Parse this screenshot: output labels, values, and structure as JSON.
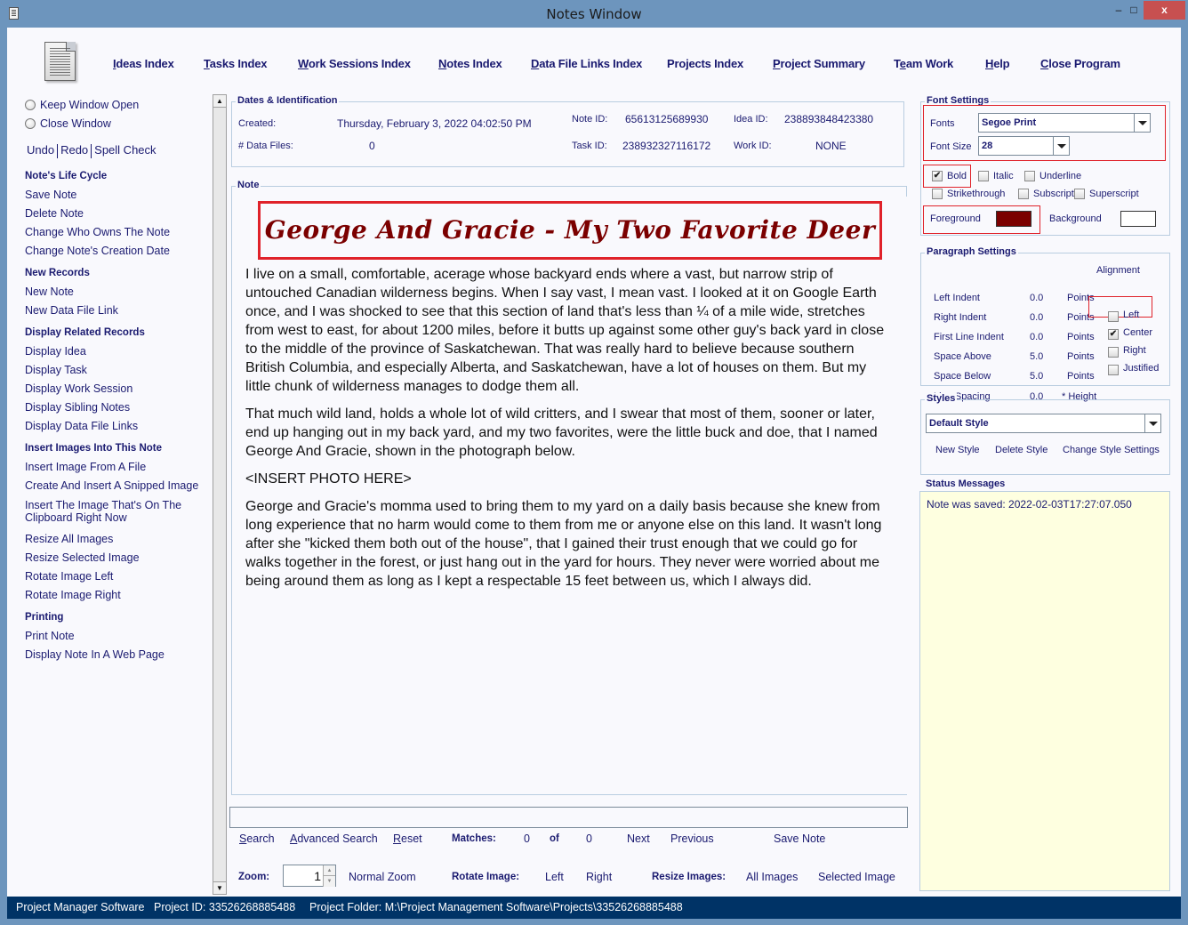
{
  "window": {
    "title": "Notes Window",
    "minimize": "–",
    "maximize": "□",
    "close": "x"
  },
  "topnav": [
    {
      "label": "Ideas Index",
      "accel": "I"
    },
    {
      "label": "Tasks Index",
      "accel": "T"
    },
    {
      "label": "Work Sessions Index",
      "accel": "W"
    },
    {
      "label": "Notes Index",
      "accel": "N"
    },
    {
      "label": "Data File Links Index",
      "accel": "D"
    },
    {
      "label": "Projects Index",
      "accel": ""
    },
    {
      "label": "Project Summary",
      "accel": "P"
    },
    {
      "label": "Team Work",
      "accel": "e"
    },
    {
      "label": "Help",
      "accel": "H"
    },
    {
      "label": "Close Program",
      "accel": "C"
    }
  ],
  "left": {
    "keep_window_open": "Keep Window Open",
    "close_window": "Close Window",
    "undo": "Undo",
    "redo": "Redo",
    "spell_check": "Spell Check",
    "sections": [
      {
        "title": "Note's Life Cycle",
        "items": [
          "Save Note",
          "Delete Note",
          "Change Who Owns The Note",
          "Change Note's Creation Date"
        ]
      },
      {
        "title": "New Records",
        "items": [
          "New Note",
          "New Data File Link"
        ]
      },
      {
        "title": "Display Related Records",
        "items": [
          "Display Idea",
          "Display Task",
          "Display Work Session",
          "Display Sibling Notes",
          "Display Data File Links"
        ]
      },
      {
        "title": "Insert Images Into This Note",
        "items": [
          "Insert Image From A File",
          "Create And Insert A Snipped Image",
          "Insert The Image That's On The",
          "Clipboard Right Now",
          "Resize All Images",
          "Resize Selected Image",
          "Rotate Image Left",
          "Rotate Image Right"
        ]
      },
      {
        "title": "Printing",
        "items": [
          "Print Note",
          "Display Note In A Web Page"
        ]
      }
    ]
  },
  "dates": {
    "group_title": "Dates & Identification",
    "created_label": "Created:",
    "created_value": "Thursday, February 3, 2022   04:02:50 PM",
    "data_files_label": "# Data Files:",
    "data_files_value": "0",
    "note_id_label": "Note ID:",
    "note_id_value": "65613125689930",
    "task_id_label": "Task ID:",
    "task_id_value": "238932327116172",
    "idea_id_label": "Idea ID:",
    "idea_id_value": "238893848423380",
    "work_id_label": "Work ID:",
    "work_id_value": "NONE"
  },
  "note": {
    "group_title": "Note",
    "title": "George And Gracie - My Two Favorite Deer",
    "title_color": "#7b0000",
    "paragraphs": [
      "I live on a small, comfortable, acerage whose backyard ends where a vast, but narrow strip of untouched Canadian wilderness begins. When I say vast, I mean vast. I looked at it on Google Earth once, and I was shocked to see that this section of land that's less than ¼ of a mile wide,  stretches from west to east, for about 1200 miles, before it butts up against some other guy's back yard in close to the middle of the province of Saskatchewan. That was really hard to believe because southern British Columbia, and especially Alberta, and Saskatchewan, have a lot of houses on them. But my little chunk of wilderness manages to dodge them all.",
      "That much wild land, holds a whole lot of wild critters, and I swear that most of them, sooner or later, end up hanging out in my back yard, and my two favorites, were the little buck and doe, that I named George And Gracie, shown in the photograph below.",
      "<INSERT PHOTO HERE>",
      "George and Gracie's momma used to bring them to my yard on a daily basis because she knew from long experience that no harm would come to them from me or anyone else on this land. It wasn't long after she \"kicked them both out of the house\", that I gained their trust enough that we could go for walks together in the forest, or just hang out in the yard for hours. They never were worried about me being around them as long as I kept a respectable 15 feet between us, which I always did."
    ]
  },
  "search": {
    "value": "",
    "search": "Search",
    "advanced_search": "Advanced Search",
    "reset": "Reset",
    "matches_label": "Matches:",
    "matches_current": "0",
    "of_label": "of",
    "matches_total": "0",
    "next": "Next",
    "previous": "Previous",
    "save_note": "Save Note"
  },
  "zoombar": {
    "zoom_label": "Zoom:",
    "zoom_value": "1",
    "normal_zoom": "Normal Zoom",
    "rotate_label": "Rotate Image:",
    "rotate_left": "Left",
    "rotate_right": "Right",
    "resize_label": "Resize Images:",
    "all_images": "All Images",
    "selected_image": "Selected Image"
  },
  "font_settings": {
    "group_title": "Font Settings",
    "fonts_label": "Fonts",
    "font_value": "Segoe Print",
    "size_label": "Font Size",
    "size_value": "28",
    "bold": {
      "label": "Bold",
      "checked": true
    },
    "italic": {
      "label": "Italic",
      "checked": false
    },
    "underline": {
      "label": "Underline",
      "checked": false
    },
    "strikethrough": {
      "label": "Strikethrough",
      "checked": false
    },
    "subscript": {
      "label": "Subscript",
      "checked": false
    },
    "superscript": {
      "label": "Superscript",
      "checked": false
    },
    "foreground_label": "Foreground",
    "foreground_color": "#7b0000",
    "background_label": "Background",
    "background_color": "#ffffff"
  },
  "paragraph_settings": {
    "group_title": "Paragraph Settings",
    "rows": [
      {
        "label": "Left Indent",
        "value": "0.0",
        "unit": "Points"
      },
      {
        "label": "Right Indent",
        "value": "0.0",
        "unit": "Points"
      },
      {
        "label": "First Line Indent",
        "value": "0.0",
        "unit": "Points"
      },
      {
        "label": "Space Above",
        "value": "5.0",
        "unit": "Points"
      },
      {
        "label": "Space Below",
        "value": "5.0",
        "unit": "Points"
      },
      {
        "label": "Line Spacing",
        "value": "0.0",
        "unit": "* Height"
      }
    ],
    "alignment_label": "Alignment",
    "alignments": [
      {
        "label": "Left",
        "checked": false
      },
      {
        "label": "Center",
        "checked": true
      },
      {
        "label": "Right",
        "checked": false
      },
      {
        "label": "Justified",
        "checked": false
      }
    ]
  },
  "styles": {
    "group_title": "Styles",
    "selected": "Default Style",
    "new_style": "New Style",
    "delete_style": "Delete Style",
    "change_style": "Change Style Settings"
  },
  "status_messages": {
    "group_title": "Status Messages",
    "message": "Note was saved:  2022-02-03T17:27:07.050"
  },
  "statusbar": {
    "app": "Project Manager Software",
    "project_id": "Project ID:  33526268885488",
    "project_folder": "Project Folder: M:\\Project Management Software\\Projects\\33526268885488"
  },
  "check_mark": "✔"
}
